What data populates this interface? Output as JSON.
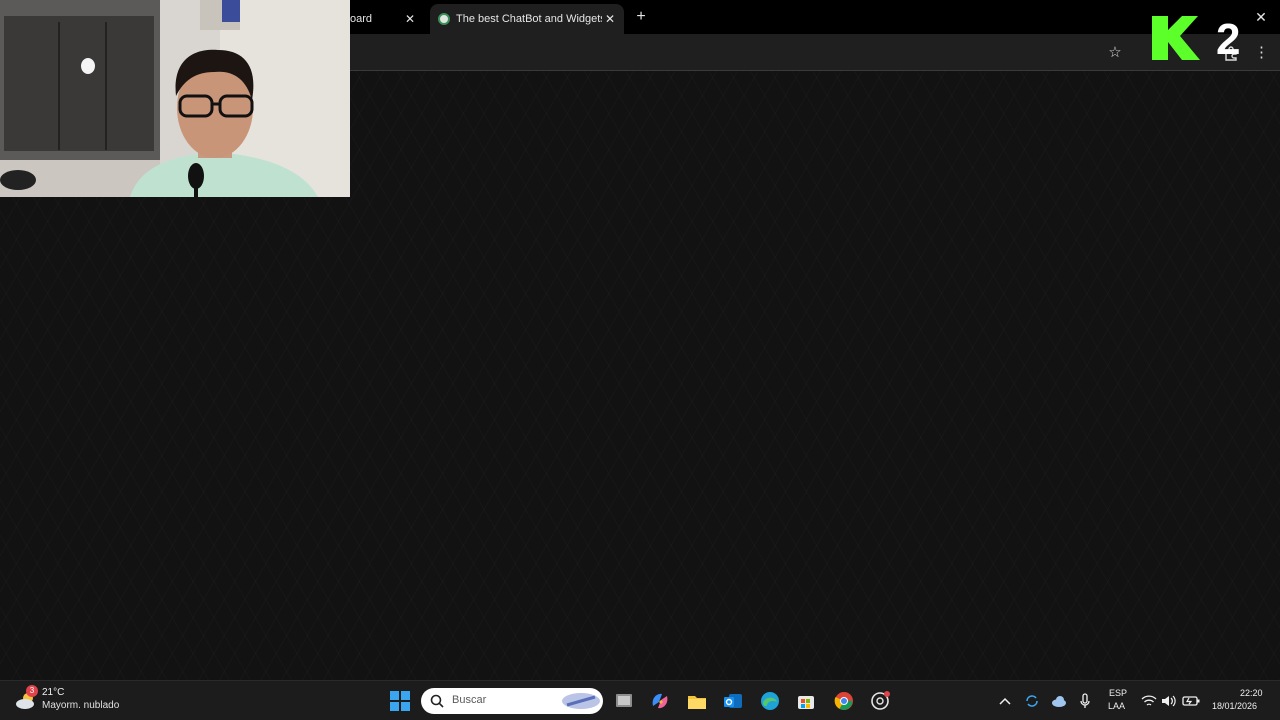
{
  "browser": {
    "tabs": [
      {
        "label": "oard",
        "active": false
      },
      {
        "label": "The best ChatBot and Widgets",
        "active": true
      }
    ],
    "close_glyph": "✕",
    "new_tab_glyph": "+",
    "window_close_glyph": "✕",
    "bookmark_glyph": "☆",
    "menu_glyph": "⋮"
  },
  "overlay": {
    "logo_text": "K2",
    "logo_color": "#5cff2a"
  },
  "taskbar": {
    "weather": {
      "temperature": "21°C",
      "description": "Mayorm. nublado",
      "badge": "3"
    },
    "search_placeholder": "Buscar",
    "language": {
      "code": "ESP",
      "layout": "LAA"
    },
    "time": "22:20",
    "date": "18/01/2026",
    "icons": [
      "windows-start-icon",
      "task-view-icon",
      "copilot-icon",
      "file-explorer-icon",
      "outlook-icon",
      "edge-icon",
      "store-icon",
      "chrome-icon",
      "chatgpt-icon"
    ],
    "tray_icons": [
      "chevron-up-icon",
      "sync-icon",
      "onedrive-icon",
      "microphone-icon",
      "wifi-icon",
      "speaker-icon",
      "battery-icon"
    ]
  },
  "colors": {
    "tab_strip": "#000000",
    "toolbar": "#1f1f1f",
    "page_background": "#121212",
    "taskbar": "#1c1c1c"
  }
}
